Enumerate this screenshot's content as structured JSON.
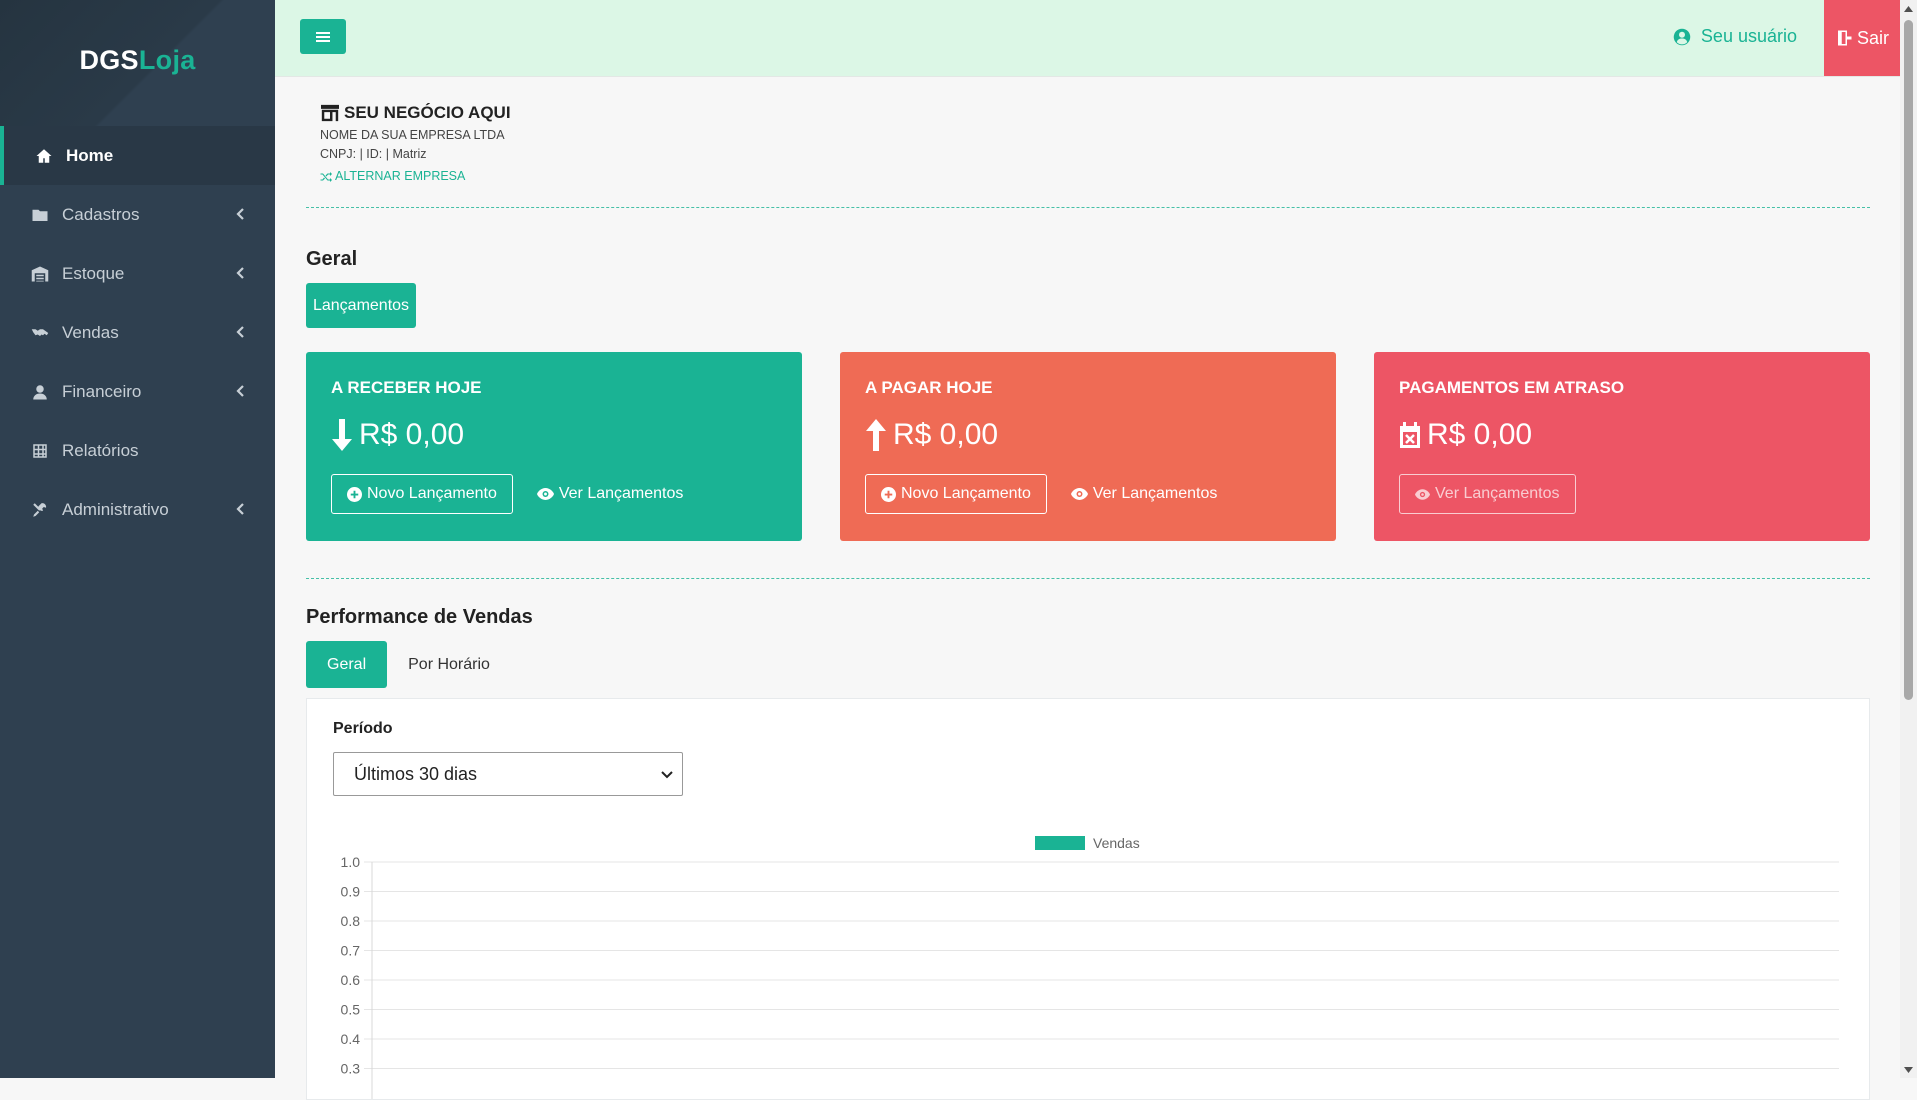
{
  "brand": {
    "part1": "DGS",
    "part2": "Loja"
  },
  "sidebar": {
    "items": [
      {
        "label": "Home",
        "icon": "home-icon",
        "active": true,
        "expandable": false
      },
      {
        "label": "Cadastros",
        "icon": "folder-icon",
        "expandable": true
      },
      {
        "label": "Estoque",
        "icon": "warehouse-icon",
        "expandable": true
      },
      {
        "label": "Vendas",
        "icon": "handshake-icon",
        "expandable": true
      },
      {
        "label": "Financeiro",
        "icon": "money-user-icon",
        "expandable": true
      },
      {
        "label": "Relatórios",
        "icon": "table-icon",
        "expandable": false
      },
      {
        "label": "Administrativo",
        "icon": "tools-icon",
        "expandable": true
      }
    ]
  },
  "topbar": {
    "user_label": "Seu usuário",
    "logout_label": "Sair"
  },
  "company": {
    "title": "SEU NEGÓCIO AQUI",
    "legal_name": "NOME DA SUA EMPRESA LTDA",
    "details": "CNPJ: | ID: | Matriz",
    "switch_label": "ALTERNAR EMPRESA"
  },
  "general": {
    "title": "Geral",
    "entries_button": "Lançamentos",
    "cards": [
      {
        "title": "A RECEBER HOJE",
        "amount": "R$ 0,00",
        "icon": "arrow-down-icon",
        "color": "#1ab394",
        "new_label": "Novo Lançamento",
        "view_label": "Ver Lançamentos"
      },
      {
        "title": "A PAGAR HOJE",
        "amount": "R$ 0,00",
        "icon": "arrow-up-icon",
        "color": "#ef6b55",
        "new_label": "Novo Lançamento",
        "view_label": "Ver Lançamentos"
      },
      {
        "title": "PAGAMENTOS EM ATRASO",
        "amount": "R$ 0,00",
        "icon": "calendar-x-icon",
        "color": "#ed5565",
        "view_label": "Ver Lançamentos"
      }
    ]
  },
  "performance": {
    "title": "Performance de Vendas",
    "tabs": [
      "Geral",
      "Por Horário"
    ],
    "period_label": "Período",
    "period_value": "Últimos 30 dias"
  },
  "chart_data": {
    "type": "bar",
    "series": [
      {
        "name": "Vendas",
        "values": [],
        "color": "#1ab394"
      }
    ],
    "y_ticks": [
      "1.0",
      "0.9",
      "0.8",
      "0.7",
      "0.6",
      "0.5",
      "0.4",
      "0.3"
    ],
    "ylim": [
      0,
      1.0
    ],
    "legend_position": "top-center",
    "grid": true
  }
}
